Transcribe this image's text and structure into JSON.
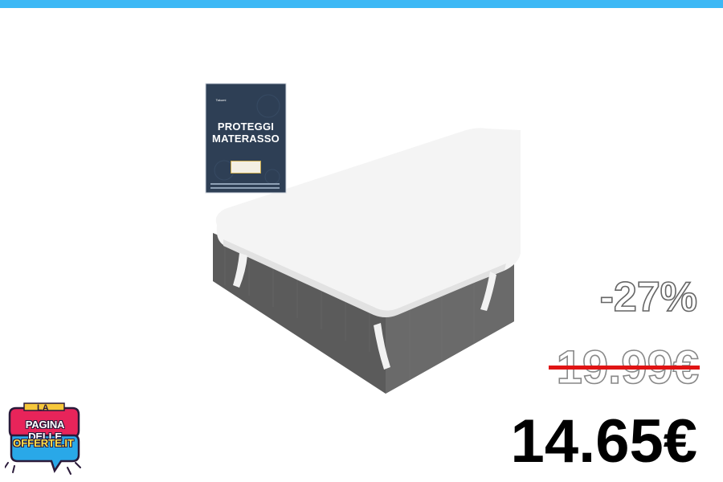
{
  "package": {
    "brand": "Takumi",
    "title": "PROTEGGI MATERASSO"
  },
  "pricing": {
    "discount": "-27%",
    "old_price": "19.99€",
    "new_price": "14.65€"
  },
  "logo": {
    "small_text": "LA",
    "line1": "PAGINA DELLE",
    "line2": "OFFERTE.IT"
  },
  "colors": {
    "top_bar": "#3db8f5",
    "strike": "#e01414",
    "package": "#2e3f55",
    "mattress_side": "#5a5a5a"
  }
}
